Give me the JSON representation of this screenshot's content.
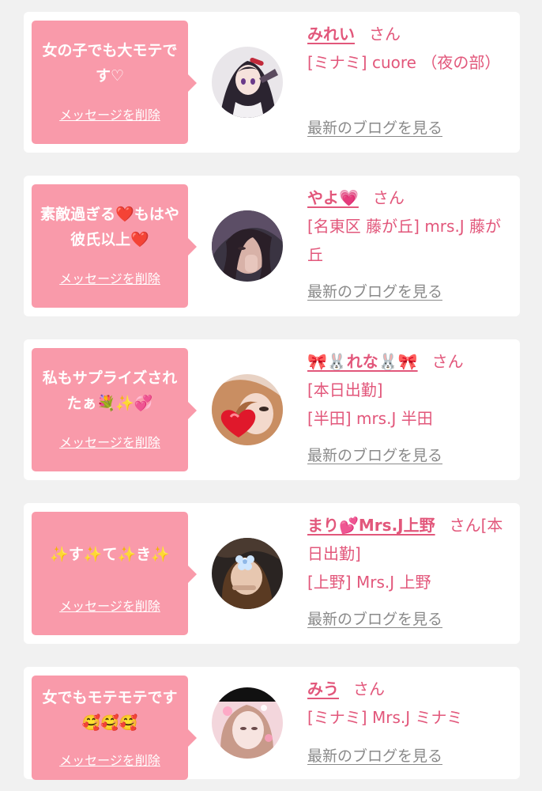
{
  "colors": {
    "accent": "#e2577b",
    "bubble": "#f99aaa",
    "muted": "#8a8a8a",
    "background": "#f1f1f1"
  },
  "delete_label": "メッセージを削除",
  "blog_label": "最新のブログを見る",
  "honorific": "さん",
  "cards": [
    {
      "message": "女の子でも大モテです♡",
      "name": "みれい",
      "detail": "[ミナミ] cuore （夜の部）"
    },
    {
      "message": "素敵過ぎる❤️もはや彼氏以上❤️",
      "name": "やよ💗",
      "detail": "[名東区 藤が丘] mrs.J 藤が丘"
    },
    {
      "message": "私もサプライズされたぁ💐✨💞",
      "name": "🎀🐰れな🐰🎀",
      "detail": "[本日出勤]\n[半田] mrs.J 半田"
    },
    {
      "message": "✨す✨て✨き✨",
      "name": "まり💕Mrs.J上野",
      "detail": "[本日出勤]\n[上野] Mrs.J 上野"
    },
    {
      "message": "女でもモテモテです🥰🥰🥰",
      "name": "みう",
      "detail": "[ミナミ] Mrs.J ミナミ"
    }
  ]
}
